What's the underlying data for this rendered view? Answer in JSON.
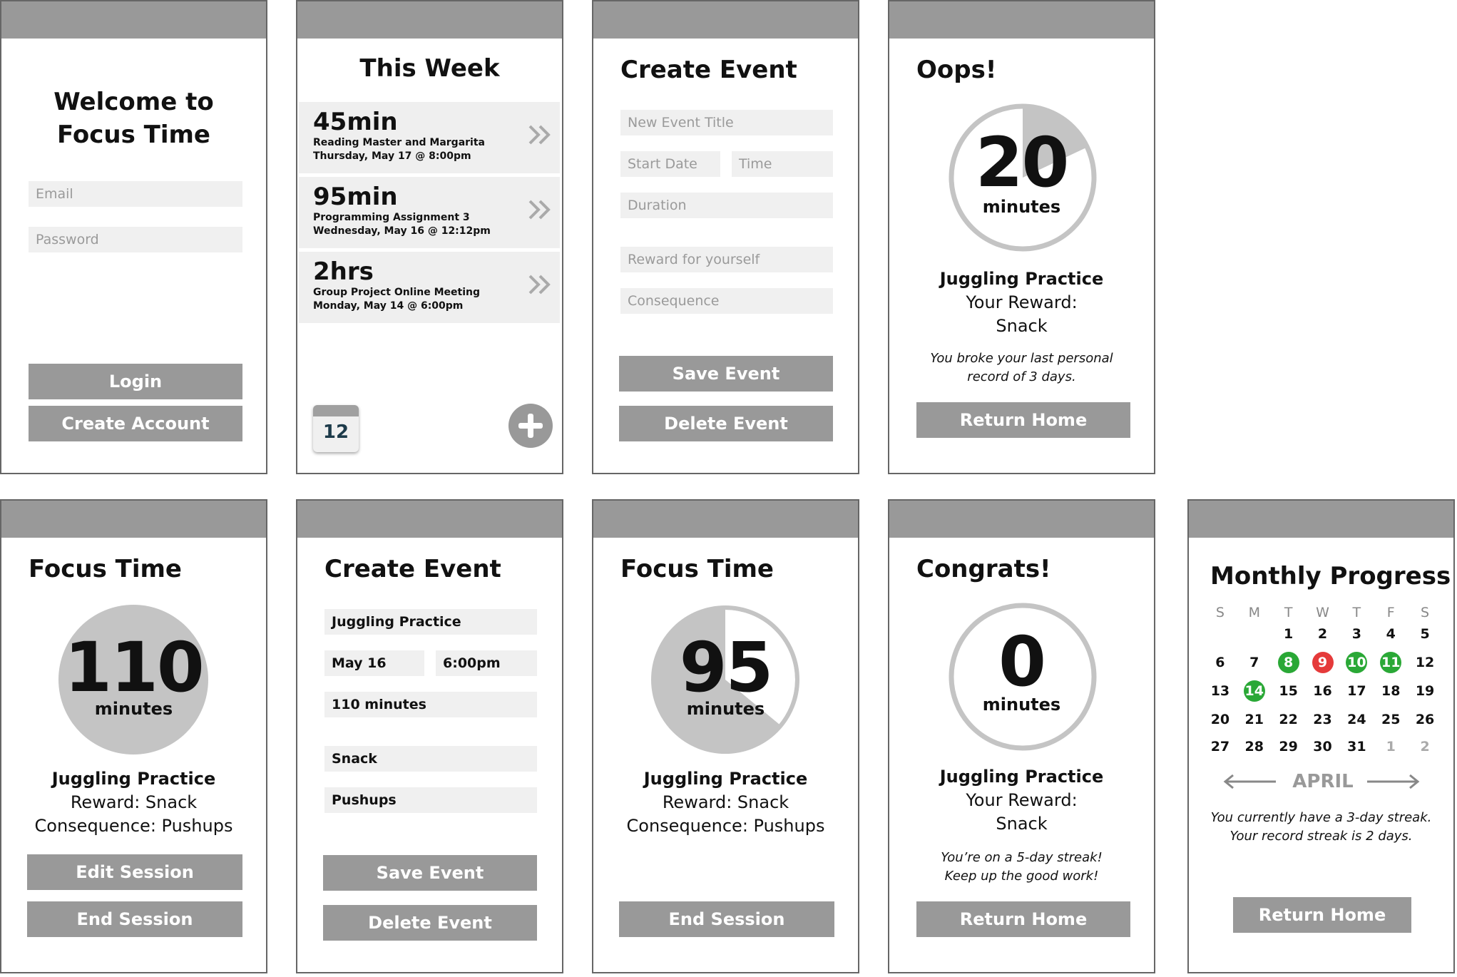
{
  "colors": {
    "header_bar": "#999999",
    "button": "#999999",
    "field": "#f0f0f0",
    "ring": "#c4c4c4",
    "streak_good": "#2aa836",
    "streak_bad": "#e53a3a"
  },
  "login": {
    "title_line1": "Welcome to",
    "title_line2": "Focus Time",
    "email_placeholder": "Email",
    "password_placeholder": "Password",
    "login_label": "Login",
    "create_account_label": "Create Account"
  },
  "week": {
    "title": "This Week",
    "events": [
      {
        "duration": "45min",
        "name": "Reading Master and Margarita",
        "when": "Thursday, May 17 @ 8:00pm"
      },
      {
        "duration": "95min",
        "name": "Programming Assignment 3",
        "when": "Wednesday, May 16 @ 12:12pm"
      },
      {
        "duration": "2hrs",
        "name": "Group Project Online Meeting",
        "when": "Monday, May 14 @ 6:00pm"
      }
    ],
    "calendar_day": "12",
    "calendar_icon": "calendar-icon",
    "add_icon": "plus-circle-icon"
  },
  "create_empty": {
    "title": "Create Event",
    "title_placeholder": "New Event Title",
    "start_date_placeholder": "Start Date",
    "time_placeholder": "Time",
    "duration_placeholder": "Duration",
    "reward_placeholder": "Reward for yourself",
    "consequence_placeholder": "Consequence",
    "save_label": "Save Event",
    "delete_label": "Delete Event"
  },
  "oops": {
    "title": "Oops!",
    "number": "20",
    "unit": "minutes",
    "progress_fraction": 0.18,
    "event": "Juggling Practice",
    "reward_label": "Your Reward:",
    "reward": "Snack",
    "note_line1": "You broke your last personal",
    "note_line2": "record of 3 days.",
    "button": "Return Home"
  },
  "focus110": {
    "title": "Focus Time",
    "number": "110",
    "unit": "minutes",
    "event": "Juggling Practice",
    "reward": "Reward: Snack",
    "consequence": "Consequence: Pushups",
    "edit_label": "Edit Session",
    "end_label": "End Session"
  },
  "create_filled": {
    "title": "Create Event",
    "title_value": "Juggling Practice",
    "date_value": "May 16",
    "time_value": "6:00pm",
    "duration_value": "110 minutes",
    "reward_value": "Snack",
    "consequence_value": "Pushups",
    "save_label": "Save Event",
    "delete_label": "Delete Event"
  },
  "focus95": {
    "title": "Focus Time",
    "number": "95",
    "unit": "minutes",
    "remaining_fraction": 0.36,
    "event": "Juggling Practice",
    "reward": "Reward: Snack",
    "consequence": "Consequence: Pushups",
    "end_label": "End Session"
  },
  "congrats": {
    "title": "Congrats!",
    "number": "0",
    "unit": "minutes",
    "event": "Juggling Practice",
    "reward_label": "Your Reward:",
    "reward": "Snack",
    "note_line1": "You’re on a 5-day streak!",
    "note_line2": "Keep up the good work!",
    "button": "Return Home"
  },
  "monthly": {
    "title": "Monthly Progress",
    "weekdays": [
      "S",
      "M",
      "T",
      "W",
      "T",
      "F",
      "S"
    ],
    "weeks": [
      [
        {
          "d": ""
        },
        {
          "d": ""
        },
        {
          "d": "1"
        },
        {
          "d": "2"
        },
        {
          "d": "3"
        },
        {
          "d": "4"
        },
        {
          "d": "5"
        }
      ],
      [
        {
          "d": "6"
        },
        {
          "d": "7"
        },
        {
          "d": "8",
          "s": "good"
        },
        {
          "d": "9",
          "s": "bad"
        },
        {
          "d": "10",
          "s": "good"
        },
        {
          "d": "11",
          "s": "good"
        },
        {
          "d": "12"
        }
      ],
      [
        {
          "d": "13"
        },
        {
          "d": "14",
          "s": "good"
        },
        {
          "d": "15"
        },
        {
          "d": "16"
        },
        {
          "d": "17"
        },
        {
          "d": "18"
        },
        {
          "d": "19"
        }
      ],
      [
        {
          "d": "20"
        },
        {
          "d": "21"
        },
        {
          "d": "22"
        },
        {
          "d": "23"
        },
        {
          "d": "24"
        },
        {
          "d": "25"
        },
        {
          "d": "26"
        }
      ],
      [
        {
          "d": "27"
        },
        {
          "d": "28"
        },
        {
          "d": "29"
        },
        {
          "d": "30"
        },
        {
          "d": "31"
        },
        {
          "d": "1",
          "s": "next"
        },
        {
          "d": "2",
          "s": "next"
        }
      ]
    ],
    "month": "APRIL",
    "note_line1": "You currently have a 3-day streak.",
    "note_line2": "Your record streak is 2 days.",
    "button": "Return Home"
  }
}
